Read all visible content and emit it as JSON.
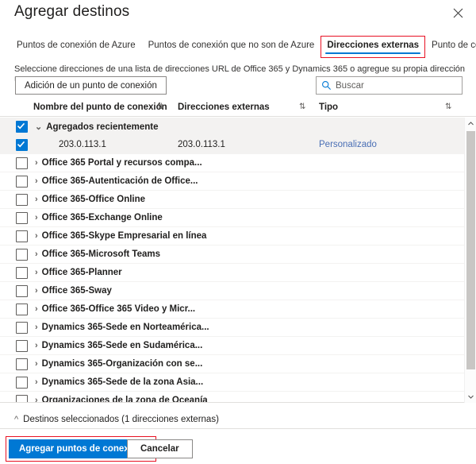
{
  "window": {
    "title": "Agregar destinos",
    "close_icon": "close-icon"
  },
  "tabs": [
    {
      "label": "Puntos de conexión de Azure",
      "selected": false
    },
    {
      "label": "Puntos de conexión que no son de Azure",
      "selected": false
    },
    {
      "label": "Direcciones externas",
      "selected": true
    },
    {
      "label": "Punto de conexión reciente",
      "selected": false
    }
  ],
  "description": "Seleccione direcciones de una lista de direcciones URL de Office 365 y Dynamics 365 o agregue su propia dirección URL o IP.",
  "toolbar": {
    "add_endpoint_label": "Adición de un punto de conexión",
    "search_placeholder": "Buscar",
    "search_value": "",
    "search_icon": "search-icon"
  },
  "table": {
    "columns": [
      {
        "label": "Nombre del punto de conexión",
        "sort_icon": "sort-updown-icon"
      },
      {
        "label": "Direcciones externas",
        "sort_icon": "sort-updown-icon"
      },
      {
        "label": "Tipo",
        "sort_icon": "sort-updown-icon"
      }
    ],
    "rows": [
      {
        "name": "Agregados recientemente",
        "address": "",
        "type": "",
        "checked": true,
        "kind": "group",
        "expanded": true
      },
      {
        "name": "203.0.113.1",
        "address": "203.0.113.1",
        "type": "Personalizado",
        "checked": true,
        "kind": "child",
        "expanded": false
      },
      {
        "name": "Office 365 Portal y recursos compa...",
        "address": "",
        "type": "",
        "checked": false,
        "kind": "group",
        "expanded": false
      },
      {
        "name": "Office 365-Autenticación de Office...",
        "address": "",
        "type": "",
        "checked": false,
        "kind": "group",
        "expanded": false
      },
      {
        "name": "Office 365-Office Online",
        "address": "",
        "type": "",
        "checked": false,
        "kind": "group",
        "expanded": false
      },
      {
        "name": "Office 365-Exchange Online",
        "address": "",
        "type": "",
        "checked": false,
        "kind": "group",
        "expanded": false
      },
      {
        "name": "Office 365-Skype Empresarial en línea",
        "address": "",
        "type": "",
        "checked": false,
        "kind": "group",
        "expanded": false
      },
      {
        "name": "Office 365-Microsoft Teams",
        "address": "",
        "type": "",
        "checked": false,
        "kind": "group",
        "expanded": false
      },
      {
        "name": "Office 365-Planner",
        "address": "",
        "type": "",
        "checked": false,
        "kind": "group",
        "expanded": false
      },
      {
        "name": "Office 365-Sway",
        "address": "",
        "type": "",
        "checked": false,
        "kind": "group",
        "expanded": false
      },
      {
        "name": "Office 365-Office 365 Video y Micr...",
        "address": "",
        "type": "",
        "checked": false,
        "kind": "group",
        "expanded": false
      },
      {
        "name": "Dynamics 365-Sede en Norteamérica...",
        "address": "",
        "type": "",
        "checked": false,
        "kind": "group",
        "expanded": false
      },
      {
        "name": "Dynamics 365-Sede en Sudamérica...",
        "address": "",
        "type": "",
        "checked": false,
        "kind": "group",
        "expanded": false
      },
      {
        "name": "Dynamics 365-Organización con se...",
        "address": "",
        "type": "",
        "checked": false,
        "kind": "group",
        "expanded": false
      },
      {
        "name": "Dynamics 365-Sede de la zona Asia...",
        "address": "",
        "type": "",
        "checked": false,
        "kind": "group",
        "expanded": false
      },
      {
        "name": "Organizaciones de la zona de Oceanía",
        "address": "",
        "type": "",
        "checked": false,
        "kind": "group",
        "expanded": false
      }
    ]
  },
  "selected_destinations": {
    "label": "Destinos seleccionados (1 direcciones externas)",
    "expanded": true
  },
  "footer": {
    "primary_label": "Agregar puntos de conexión",
    "secondary_label": "Cancelar"
  },
  "colors": {
    "accent": "#0078d4",
    "highlight_box": "#e81123",
    "link": "#4a6fb5",
    "row_selected_bg": "#f3f2f1"
  }
}
